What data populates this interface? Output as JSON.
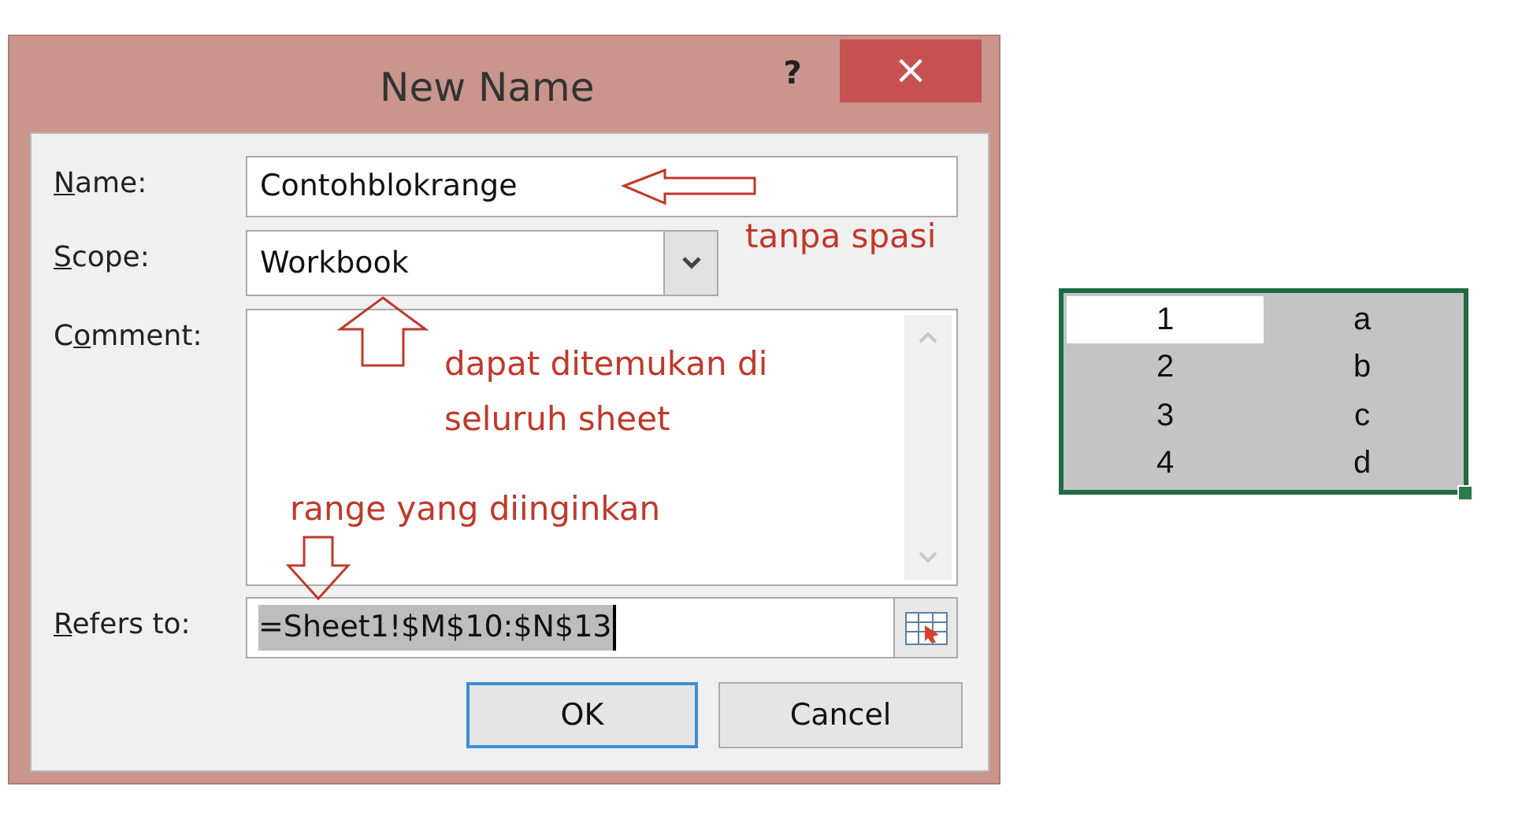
{
  "dialog": {
    "title": "New Name",
    "help": "?",
    "close": "×",
    "fields": [
      {
        "kind": "text",
        "label": {
          "key": "N",
          "after": "ame:"
        },
        "value": "Contohblokrange"
      },
      {
        "kind": "dropdown",
        "label": {
          "key": "S",
          "after": "cope:"
        },
        "value": "Workbook"
      },
      {
        "kind": "textarea",
        "label": {
          "before": "C",
          "key": "o",
          "after": "mment:"
        }
      },
      {
        "kind": "reference",
        "label": {
          "key": "R",
          "after": "efers to:"
        },
        "value": "=Sheet1!$M$10:$N$13"
      }
    ],
    "buttons": [
      {
        "label": "OK",
        "default": true
      },
      {
        "label": "Cancel",
        "default": false
      }
    ]
  },
  "annotations": [
    {
      "kind": "left-arrow",
      "text": "tanpa spasi"
    },
    {
      "kind": "up-arrow",
      "text": "dapat ditemukan di seluruh sheet"
    },
    {
      "kind": "down-arrow",
      "text": "range yang diinginkan"
    }
  ],
  "sheet": {
    "rows": [
      {
        "cells": [
          {
            "text": "1",
            "active": true
          },
          {
            "text": "a",
            "active": false
          }
        ]
      },
      {
        "cells": [
          {
            "text": "2",
            "active": false
          },
          {
            "text": "b",
            "active": false
          }
        ]
      },
      {
        "cells": [
          {
            "text": "3",
            "active": false
          },
          {
            "text": "c",
            "active": false
          }
        ]
      },
      {
        "cells": [
          {
            "text": "4",
            "active": false
          },
          {
            "text": "d",
            "active": false
          }
        ]
      }
    ]
  }
}
